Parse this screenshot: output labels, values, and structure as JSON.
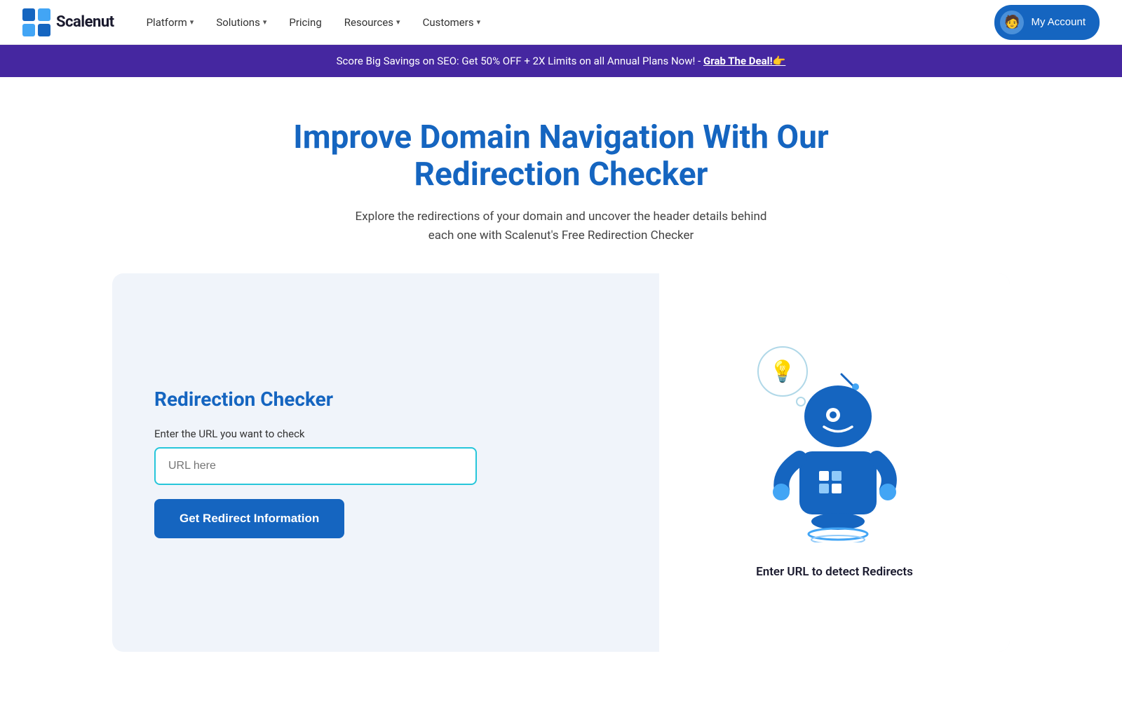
{
  "navbar": {
    "logo_text": "Scalenut",
    "nav_items": [
      {
        "label": "Platform",
        "has_dropdown": true
      },
      {
        "label": "Solutions",
        "has_dropdown": true
      },
      {
        "label": "Pricing",
        "has_dropdown": false
      },
      {
        "label": "Resources",
        "has_dropdown": true
      },
      {
        "label": "Customers",
        "has_dropdown": true
      }
    ],
    "my_account_label": "My Account"
  },
  "promo_banner": {
    "text": "Score Big Savings on SEO: Get 50% OFF + 2X Limits on all Annual Plans Now! - ",
    "cta": "Grab The Deal!👉"
  },
  "hero": {
    "title": "Improve Domain Navigation With Our Redirection Checker",
    "subtitle": "Explore the redirections of your domain and uncover the header details behind each one with Scalenut's Free Redirection Checker"
  },
  "tool": {
    "title": "Redirection Checker",
    "input_label": "Enter the URL you want to check",
    "input_placeholder": "URL here",
    "button_label": "Get Redirect Information",
    "robot_caption": "Enter URL to detect Redirects"
  }
}
